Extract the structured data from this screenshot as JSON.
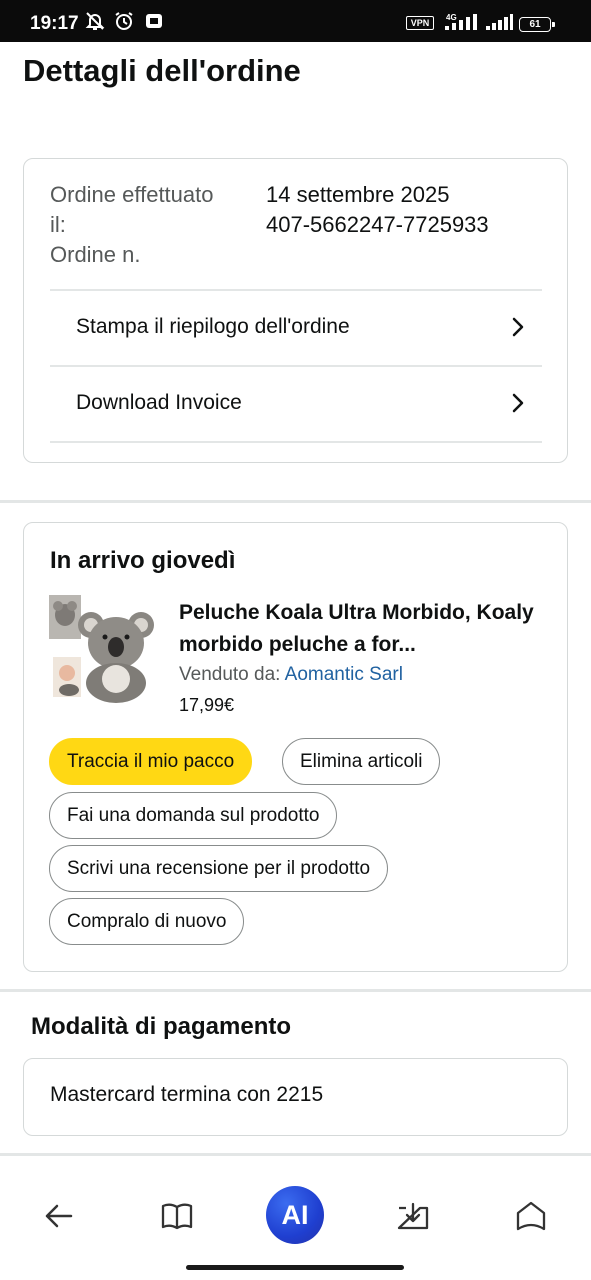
{
  "status_bar": {
    "time": "19:17",
    "vpn": "VPN",
    "network": "4G",
    "battery": "61"
  },
  "page": {
    "title": "Dettagli dell'ordine"
  },
  "order_summary": {
    "placed_label": "Ordine effettuato il:",
    "number_label": "Ordine n.",
    "placed_value": "14 settembre 2025",
    "number_value": "407-5662247-7725933",
    "print_label": "Stampa il riepilogo dell'ordine",
    "invoice_label": "Download Invoice"
  },
  "shipment": {
    "heading": "In arrivo giovedì",
    "product": {
      "title": "Peluche Koala Ultra Morbido, Koaly morbido peluche a for...",
      "seller_prefix": "Venduto da:",
      "seller_name": "Aomantic Sarl",
      "price": "17,99€"
    },
    "actions": {
      "track": "Traccia il mio pacco",
      "delete": "Elimina articoli",
      "question": "Fai una domanda sul prodotto",
      "review": "Scrivi una recensione per il prodotto",
      "buy_again": "Compralo di nuovo"
    }
  },
  "payment": {
    "heading": "Modalità di pagamento",
    "method": "Mastercard  termina con 2215"
  },
  "nav": {
    "ai_label": "AI",
    "icons": [
      "back-arrow-icon",
      "book-icon",
      "ai-assistant-icon",
      "download-tray-icon",
      "home-icon"
    ]
  },
  "colors": {
    "primary_button": "#ffd814",
    "link": "#2162a1",
    "ai_button": "#1f3fd0",
    "status_bar": "#0b0b0b"
  }
}
